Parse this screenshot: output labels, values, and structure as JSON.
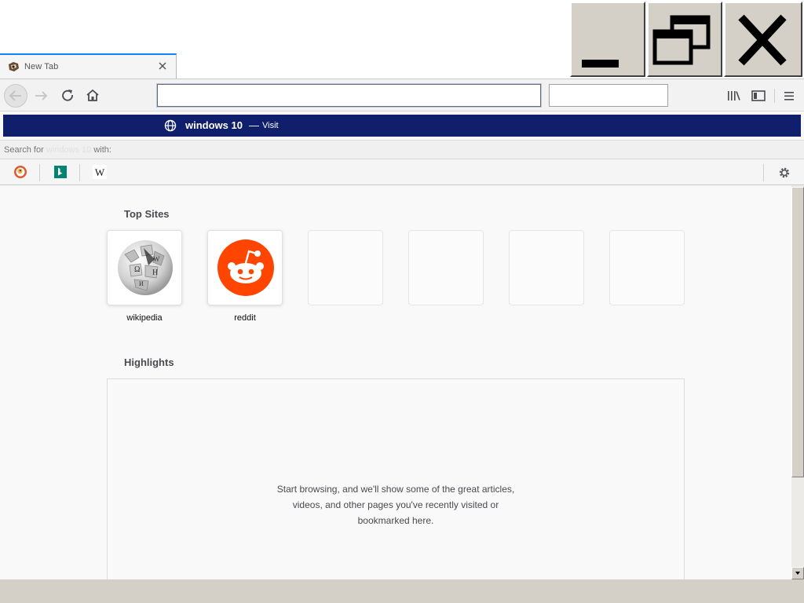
{
  "tab": {
    "title": "New Tab"
  },
  "toolbar": {
    "url_value": "",
    "search_value": ""
  },
  "suggestion": {
    "query": "windows 10",
    "dash": "—",
    "action": "Visit"
  },
  "search_with": {
    "prefix": "Search for",
    "query": "windows 10",
    "suffix": "with:"
  },
  "search_engines": [
    {
      "name": "duckduckgo-icon"
    },
    {
      "name": "bing-icon"
    },
    {
      "name": "wikipedia-icon",
      "glyph": "W"
    }
  ],
  "top_sites": {
    "title": "Top Sites",
    "tiles": [
      {
        "label": "wikipedia",
        "icon": "wikipedia-globe-icon"
      },
      {
        "label": "reddit",
        "icon": "reddit-alien-icon",
        "color": "#ff4500"
      }
    ]
  },
  "highlights": {
    "title": "Highlights",
    "empty_message_lines": [
      "Start browsing, and we'll show some of the great articles,",
      "videos, and other pages you've recently visited or",
      "bookmarked here."
    ]
  },
  "colors": {
    "accent": "#0a84ff",
    "suggestion_bg": "#0f1f6b",
    "reddit": "#ff4500"
  }
}
